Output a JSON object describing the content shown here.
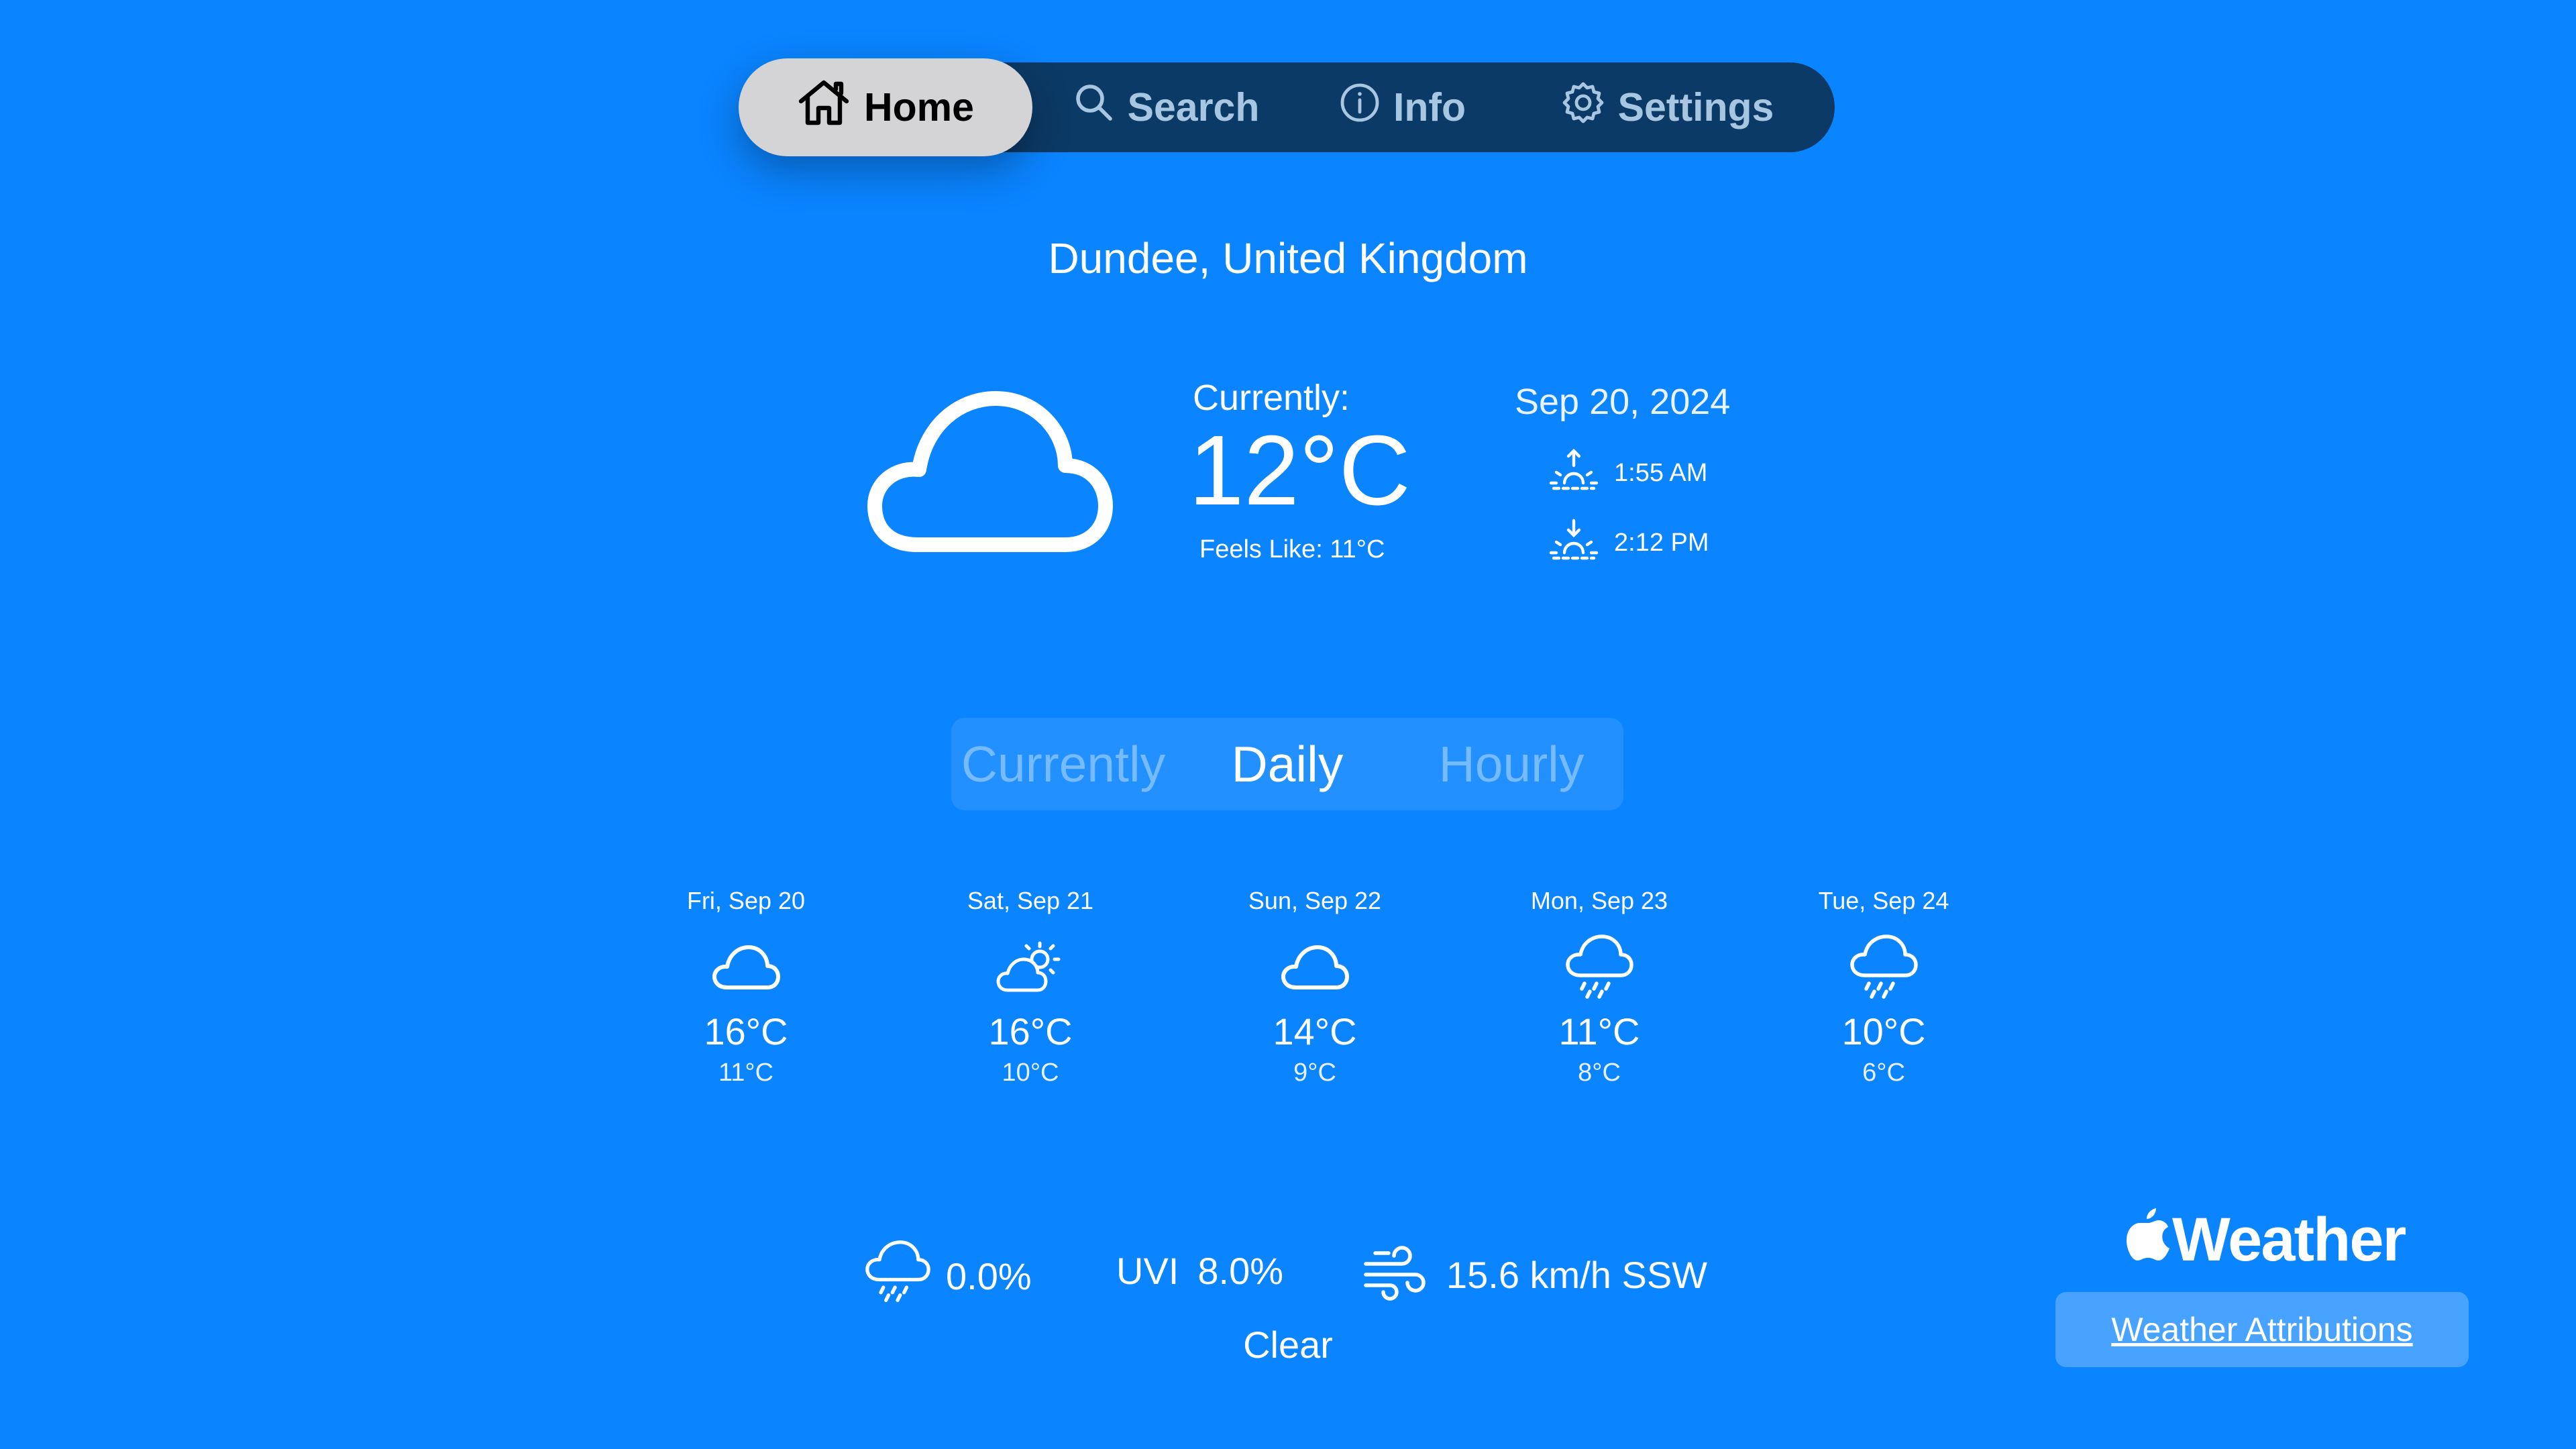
{
  "nav": {
    "tabs": [
      {
        "label": "Home",
        "icon": "house-icon",
        "active": true
      },
      {
        "label": "Search",
        "icon": "magnifier-icon",
        "active": false
      },
      {
        "label": "Info",
        "icon": "info-circle-icon",
        "active": false
      },
      {
        "label": "Settings",
        "icon": "gear-icon",
        "active": false
      }
    ]
  },
  "location": "Dundee, United Kingdom",
  "current": {
    "icon": "cloud-icon",
    "label": "Currently:",
    "temperature": "12°C",
    "feels_like": "Feels Like: 11°C",
    "date": "Sep 20, 2024",
    "sunrise": "1:55 AM",
    "sunset": "2:12 PM"
  },
  "segments": {
    "options": [
      "Currently",
      "Daily",
      "Hourly"
    ],
    "selected": "Daily"
  },
  "daily": [
    {
      "date": "Fri, Sep 20",
      "icon": "cloud-icon",
      "high": "16°C",
      "low": "11°C"
    },
    {
      "date": "Sat, Sep 21",
      "icon": "partly-sunny-icon",
      "high": "16°C",
      "low": "10°C"
    },
    {
      "date": "Sun, Sep 22",
      "icon": "cloud-icon",
      "high": "14°C",
      "low": "9°C"
    },
    {
      "date": "Mon, Sep 23",
      "icon": "rain-cloud-icon",
      "high": "11°C",
      "low": "8°C"
    },
    {
      "date": "Tue, Sep 24",
      "icon": "rain-cloud-icon",
      "high": "10°C",
      "low": "6°C"
    }
  ],
  "stats": {
    "precipitation": "0.0%",
    "uvi_label": "UVI",
    "uvi_value": "8.0%",
    "wind": "15.6 km/h SSW"
  },
  "condition": "Clear",
  "branding": {
    "name": "Weather",
    "attributions_label": "Weather Attributions"
  },
  "colors": {
    "background": "#0a84ff",
    "tabbar": "#0b3a66",
    "active_tab": "#d4d4d6"
  }
}
